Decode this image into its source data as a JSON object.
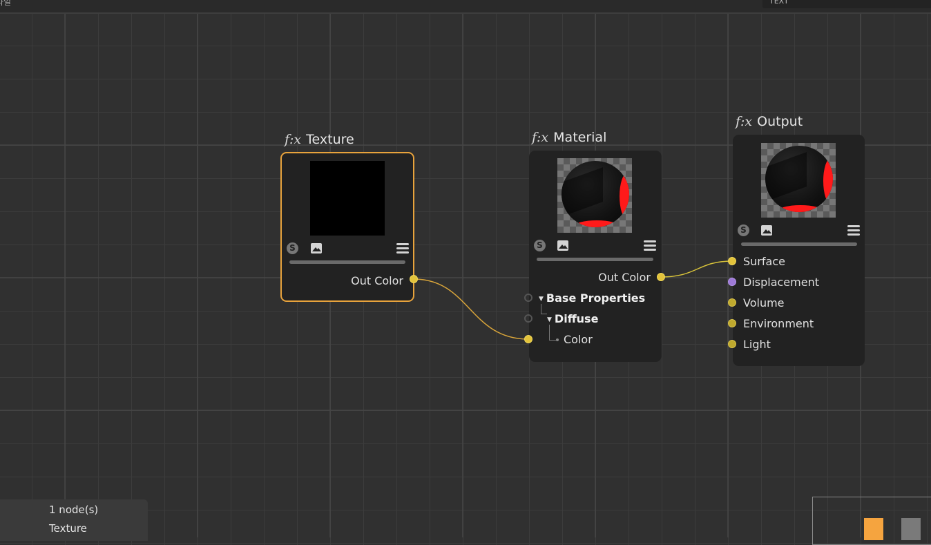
{
  "topbar": {
    "menu_text": "파일",
    "search_text": "TEXT"
  },
  "nodes": {
    "texture": {
      "title": "Texture",
      "fx": "f:x",
      "s_icon": "S",
      "outputs": [
        {
          "label": "Out Color",
          "color": "#e3c33b"
        }
      ]
    },
    "material": {
      "title": "Material",
      "fx": "f:x",
      "s_icon": "S",
      "outputs": [
        {
          "label": "Out Color",
          "color": "#e3c33b"
        }
      ],
      "inputs": [
        {
          "label": "Base Properties",
          "group": true
        },
        {
          "label": "Diffuse",
          "group": true
        },
        {
          "label": "Color",
          "color": "#e3c33b"
        }
      ]
    },
    "output": {
      "title": "Output",
      "fx": "f:x",
      "s_icon": "S",
      "inputs": [
        {
          "label": "Surface",
          "color": "#e3c33b"
        },
        {
          "label": "Displacement",
          "color": "#9d79d6"
        },
        {
          "label": "Volume",
          "color": "#bfa92e"
        },
        {
          "label": "Environment",
          "color": "#bfa92e"
        },
        {
          "label": "Light",
          "color": "#bfa92e"
        }
      ]
    }
  },
  "info_panel": {
    "count": "1 node(s)",
    "selected": "Texture"
  },
  "minimap": {
    "colors": [
      "#f5a43f",
      "#7a7a7a"
    ]
  },
  "icons": {
    "title_prefix": "function-icon",
    "node_toolbar": [
      "s-icon",
      "image-icon",
      "menu-icon"
    ]
  },
  "colors": {
    "selection": "#e8a33c",
    "wire": "#d9a53a",
    "node_bg": "#222222"
  }
}
